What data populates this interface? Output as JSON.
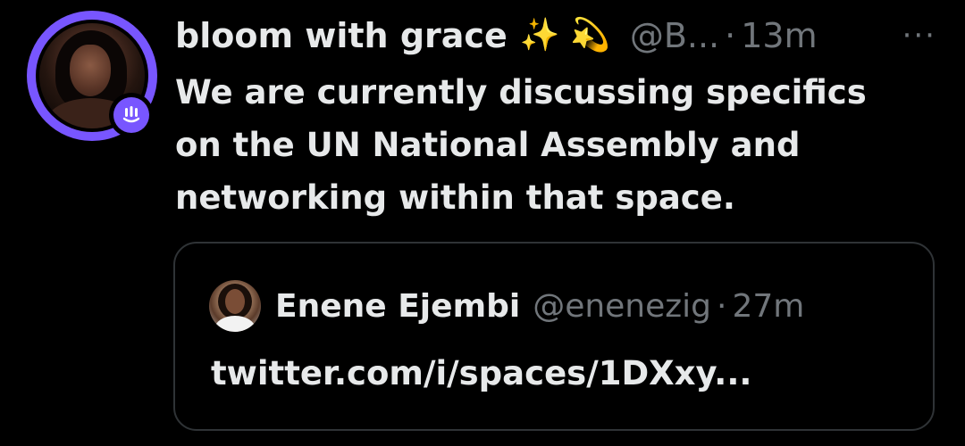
{
  "tweet": {
    "display_name": "bloom with grace",
    "emojis": "✨ 💫",
    "handle": "@B...",
    "separator": "·",
    "time": "13m",
    "more": "···",
    "text": "We are currently discussing specifics\non  the UN National Assembly and\nnetworking within that space."
  },
  "quote": {
    "display_name": "Enene Ejembi",
    "handle": "@enenezig",
    "separator": "·",
    "time": "27m",
    "link_text": "twitter.com/i/spaces/1DXxy..."
  },
  "colors": {
    "background": "#000000",
    "text_primary": "#e7e9ea",
    "text_secondary": "#71767b",
    "avatar_ring": "#7856ff",
    "border": "#2f3336"
  },
  "icons": {
    "spaces_badge": "spaces-badge-icon",
    "more": "more-options-icon"
  }
}
